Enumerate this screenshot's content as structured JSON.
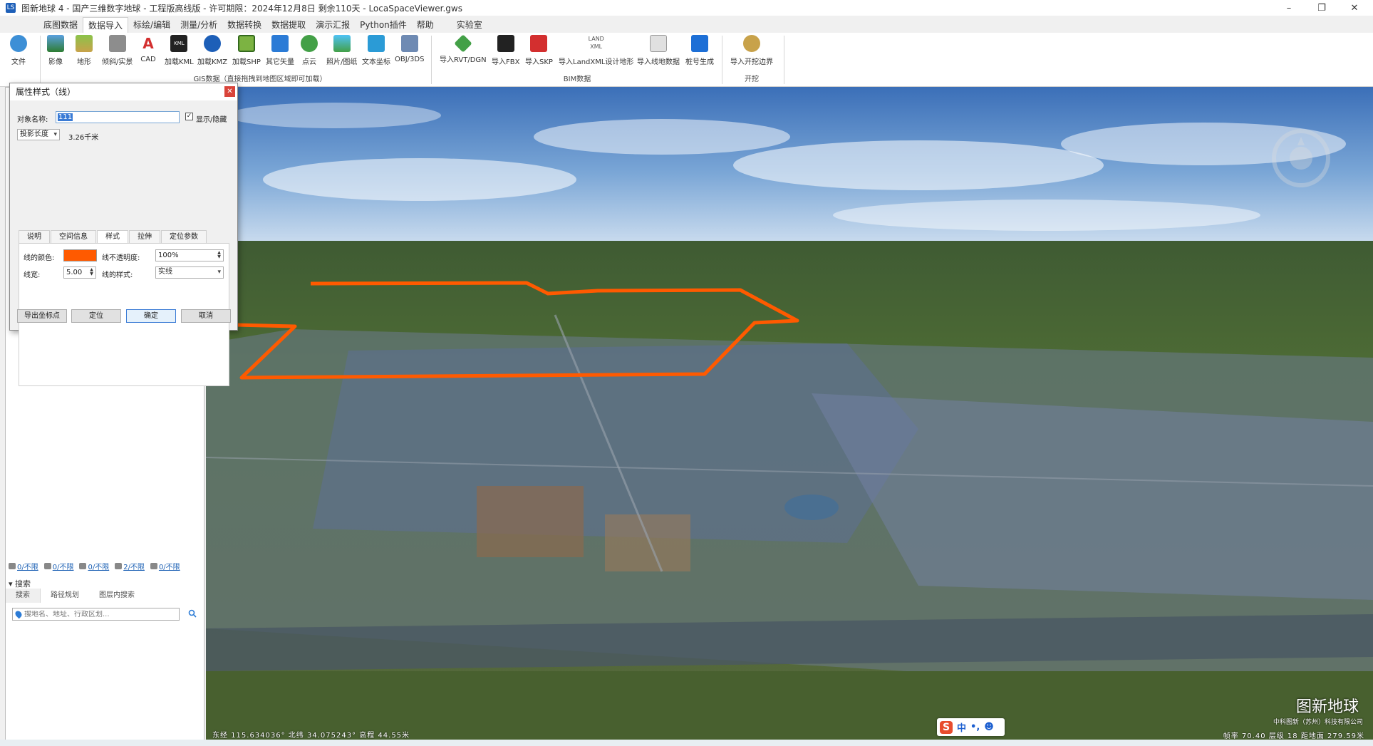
{
  "window": {
    "title": "图新地球 4 - 国产三维数字地球 - 工程版高线版 - 许可期限：2024年12月8日 剩余110天 - LocaSpaceViewer.gws",
    "app_icon": "LS"
  },
  "menu": [
    "底图数据",
    "数据导入",
    "标绘/编辑",
    "测量/分析",
    "数据转换",
    "数据提取",
    "演示汇报",
    "Python插件",
    "帮助",
    "实验室"
  ],
  "ribbon": {
    "file_label": "文件",
    "gis_buttons": [
      "影像",
      "地形",
      "倾斜/实景",
      "CAD",
      "加载KML",
      "加载KMZ",
      "加载SHP",
      "其它矢量",
      "点云",
      "照片/图纸",
      "文本坐标",
      "OBJ/3DS"
    ],
    "gis_group": "GIS数据（直接拖拽到地图区域即可加载）",
    "bim_buttons": [
      "导入RVT/DGN",
      "导入FBX",
      "导入SKP",
      "导入LandXML设计地形",
      "导入线地数据",
      "桩号生成"
    ],
    "bim_group": "BIM数据",
    "dig_buttons": [
      "导入开挖边界"
    ],
    "dig_group": "开挖"
  },
  "dialog": {
    "title": "属性样式（线）",
    "name_label": "对象名称:",
    "name_value": "111",
    "show_hide_label": "显示/隐藏",
    "show_checked": true,
    "measure_select": "投影长度",
    "measure_value": "3.26千米",
    "tabs": [
      "说明",
      "空间信息",
      "样式",
      "拉伸",
      "定位参数"
    ],
    "active_tab": "样式",
    "line_color_label": "线的颜色:",
    "line_color": "#ff5a00",
    "opacity_label": "线不透明度:",
    "opacity_value": "100%",
    "width_label": "线宽:",
    "width_value": "5.00",
    "style_label": "线的样式:",
    "style_value": "实线",
    "buttons": [
      "导出坐标点",
      "定位",
      "确定",
      "取消"
    ]
  },
  "left_panel": {
    "stats": [
      "0/不限",
      "0/不限",
      "0/不限",
      "2/不限",
      "0/不限"
    ],
    "search_header": "搜索",
    "search_tabs": [
      "搜索",
      "路径规划",
      "图层内搜索"
    ],
    "search_placeholder": "搜地名、地址、行政区划..."
  },
  "map": {
    "coords": "东经 115.634036°  北纬 34.075243°  高程 44.55米",
    "logo": "图新地球",
    "logo_sub": "中科图新（苏州）科技有限公司",
    "perf": "帧率 70.40  层级 18  距地面 279.59米",
    "line_color": "#ff5a00"
  },
  "ime": {
    "lang": "中"
  }
}
